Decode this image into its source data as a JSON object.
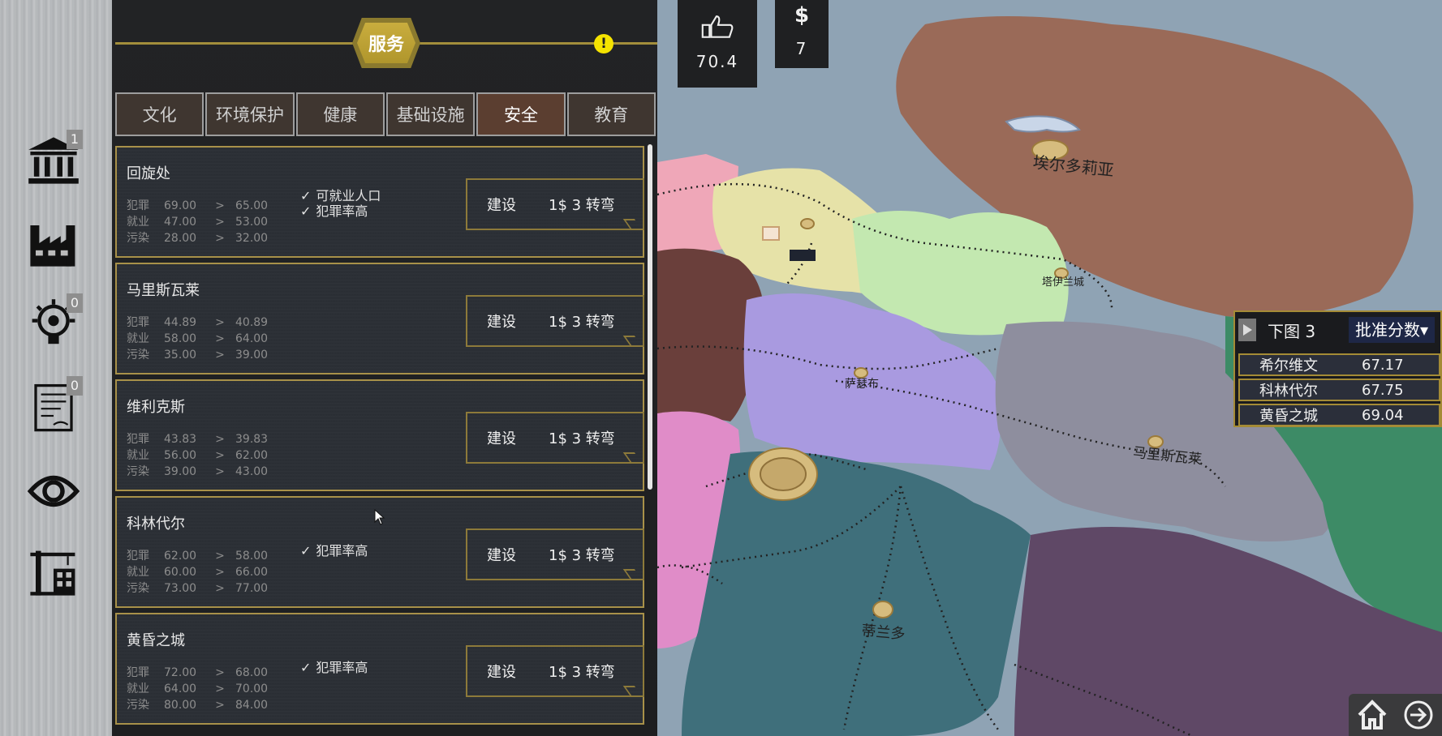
{
  "rail": {
    "items": [
      {
        "name": "government-building",
        "badge": "1"
      },
      {
        "name": "factory",
        "badge": ""
      },
      {
        "name": "research-bulb",
        "badge": "0"
      },
      {
        "name": "policy-scroll",
        "badge": "0"
      },
      {
        "name": "eye",
        "badge": ""
      },
      {
        "name": "construction-crane",
        "badge": ""
      }
    ]
  },
  "panel": {
    "title": "服务",
    "alert": "!",
    "tabs": [
      "文化",
      "环境保护",
      "健康",
      "基础设施",
      "安全",
      "教育"
    ],
    "active_tab": "安全",
    "stat_labels": [
      "犯罪",
      "就业",
      "污染"
    ],
    "arrow": ">",
    "check": "✓",
    "build_label": "建设",
    "cost_label": "1$ 3 转弯",
    "cards": [
      {
        "title": "回旋处",
        "stats": [
          [
            "69.00",
            "65.00"
          ],
          [
            "47.00",
            "53.00"
          ],
          [
            "28.00",
            "32.00"
          ]
        ],
        "benefits": [
          "可就业人口",
          "犯罪率高"
        ]
      },
      {
        "title": "马里斯瓦莱",
        "stats": [
          [
            "44.89",
            "40.89"
          ],
          [
            "58.00",
            "64.00"
          ],
          [
            "35.00",
            "39.00"
          ]
        ],
        "benefits": []
      },
      {
        "title": "维利克斯",
        "stats": [
          [
            "43.83",
            "39.83"
          ],
          [
            "56.00",
            "62.00"
          ],
          [
            "39.00",
            "43.00"
          ]
        ],
        "benefits": []
      },
      {
        "title": "科林代尔",
        "stats": [
          [
            "62.00",
            "58.00"
          ],
          [
            "60.00",
            "66.00"
          ],
          [
            "73.00",
            "77.00"
          ]
        ],
        "benefits": [
          "犯罪率高"
        ]
      },
      {
        "title": "黄昏之城",
        "stats": [
          [
            "72.00",
            "68.00"
          ],
          [
            "64.00",
            "70.00"
          ],
          [
            "80.00",
            "84.00"
          ]
        ],
        "benefits": [
          "犯罪率高"
        ]
      }
    ]
  },
  "top_stats": {
    "approval": "70.4",
    "money": "7"
  },
  "map": {
    "labels": [
      "埃尔多莉亚",
      "塔伊兰城",
      "萨瑟布",
      "马里斯瓦莱",
      "蒂兰多"
    ],
    "colors": {
      "water": "#8fa3b4",
      "brown": "#9a6a58",
      "yellow": "#e6e2a8",
      "lime": "#c3e8b0",
      "lavender": "#a99ae0",
      "gray": "#8e8e9e",
      "teal": "#3f6f7b",
      "plum": "#5f4866",
      "green": "#3d8b66",
      "pink": "#e08cc8",
      "maroon": "#6a3f3b",
      "lightpink": "#efa7b8"
    }
  },
  "ranking": {
    "title": "下图 3",
    "selector": "批准分数▾",
    "rows": [
      {
        "name": "希尔维文",
        "value": "67.17"
      },
      {
        "name": "科林代尔",
        "value": "67.75"
      },
      {
        "name": "黄昏之城",
        "value": "69.04"
      }
    ]
  },
  "nav": [
    "home-icon",
    "next-icon"
  ]
}
